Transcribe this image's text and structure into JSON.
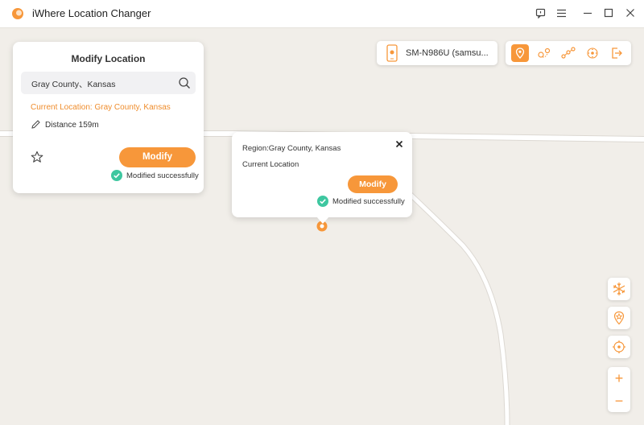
{
  "app": {
    "title": "iWhere Location Changer"
  },
  "colors": {
    "accent": "#f7973a",
    "success": "#3ec7a0",
    "map_bg": "#f1eee9",
    "road": "#ffffff"
  },
  "panel": {
    "title": "Modify Location",
    "search_value": "Gray County、Kansas",
    "current_location": "Current Location: Gray County, Kansas",
    "distance": "Distance 159m",
    "modify_label": "Modify",
    "success_text": "Modified successfully"
  },
  "popup": {
    "region": "Region:Gray County, Kansas",
    "current": "Current Location",
    "modify_label": "Modify",
    "success_text": "Modified successfully"
  },
  "device": {
    "name": "SM-N986U (samsu..."
  },
  "toolbar": {
    "modes": [
      "teleport-mode-icon",
      "two-spot-mode-icon",
      "multi-spot-mode-icon",
      "joystick-mode-icon",
      "exit-icon"
    ]
  },
  "side_tools": [
    "freeze-icon",
    "favorites-icon",
    "locate-icon"
  ],
  "zoom": {
    "in_label": "+",
    "out_label": "−"
  }
}
